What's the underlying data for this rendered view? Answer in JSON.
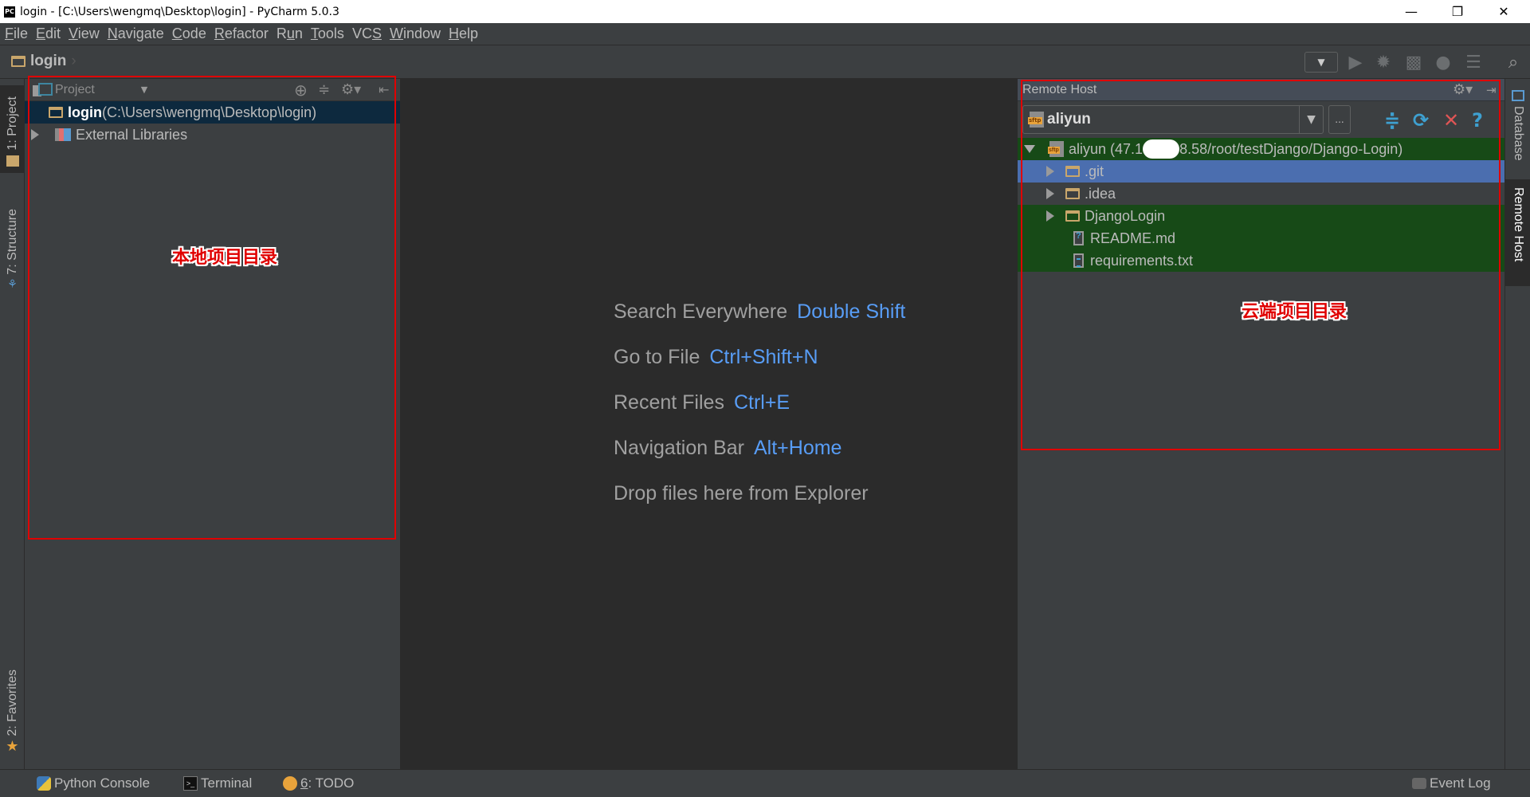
{
  "window": {
    "title": "login - [C:\\Users\\wengmq\\Desktop\\login] - PyCharm 5.0.3",
    "app_icon": "PC",
    "controls": {
      "minimize": "—",
      "restore": "❐",
      "close": "✕"
    }
  },
  "menu": [
    {
      "label": "File",
      "mnemonic": "F",
      "rest": "ile"
    },
    {
      "label": "Edit",
      "mnemonic": "E",
      "rest": "dit"
    },
    {
      "label": "View",
      "mnemonic": "V",
      "rest": "iew"
    },
    {
      "label": "Navigate",
      "mnemonic": "N",
      "rest": "avigate"
    },
    {
      "label": "Code",
      "mnemonic": "C",
      "rest": "ode"
    },
    {
      "label": "Refactor",
      "mnemonic": "R",
      "rest": "efactor"
    },
    {
      "label": "Run",
      "pre": "R",
      "mnemonic": "u",
      "rest": "n"
    },
    {
      "label": "Tools",
      "mnemonic": "T",
      "rest": "ools"
    },
    {
      "label": "VCS",
      "pre": "VC",
      "mnemonic": "S",
      "rest": ""
    },
    {
      "label": "Window",
      "mnemonic": "W",
      "rest": "indow"
    },
    {
      "label": "Help",
      "mnemonic": "H",
      "rest": "elp"
    }
  ],
  "navbar": {
    "breadcrumb": "login",
    "toolbar_icons": [
      "run-config-dropdown-icon",
      "run-icon",
      "debug-icon",
      "coverage-icon",
      "profile-icon",
      "concurrency-diagram-icon",
      "search-everywhere-icon"
    ]
  },
  "left_stripe": {
    "tabs": [
      {
        "label": "1: Project",
        "active": true
      },
      {
        "label": "7: Structure",
        "active": false
      },
      {
        "label": "2: Favorites",
        "active": false
      }
    ]
  },
  "project_panel": {
    "title": "Project",
    "tree": [
      {
        "name": "login",
        "path": " (C:\\Users\\wengmq\\Desktop\\login)",
        "type": "folder",
        "selected": true
      },
      {
        "name": "External Libraries",
        "type": "library",
        "collapsed": true
      }
    ],
    "annotation": "本地项目目录"
  },
  "editor": {
    "hints": [
      {
        "label": "Search Everywhere",
        "shortcut": "Double Shift"
      },
      {
        "label": "Go to File",
        "shortcut": "Ctrl+Shift+N"
      },
      {
        "label": "Recent Files",
        "shortcut": "Ctrl+E"
      },
      {
        "label": "Navigation Bar",
        "shortcut": "Alt+Home"
      },
      {
        "label": "Drop files here from Explorer",
        "shortcut": ""
      }
    ]
  },
  "remote_panel": {
    "title": "Remote Host",
    "host_selected": "aliyun",
    "more_label": "...",
    "root": {
      "label": "aliyun (47.1",
      "masked": true,
      "label_rest": "8.58/root/testDjango/Django-Login)"
    },
    "items": [
      {
        "name": ".git",
        "type": "folder",
        "state": "selected"
      },
      {
        "name": ".idea",
        "type": "folder",
        "state": "plain"
      },
      {
        "name": "DjangoLogin",
        "type": "folder",
        "state": "green"
      },
      {
        "name": "README.md",
        "type": "file-unknown",
        "state": "green"
      },
      {
        "name": "requirements.txt",
        "type": "file-text",
        "state": "green"
      }
    ],
    "annotation": "云端项目目录"
  },
  "right_stripe": {
    "tabs": [
      {
        "label": "Database",
        "active": false
      },
      {
        "label": "Remote Host",
        "active": true
      }
    ]
  },
  "statusbar": {
    "python_console": "Python Console",
    "terminal": "Terminal",
    "todo_num": "6",
    "todo_rest": ": TODO",
    "event_log": "Event Log"
  },
  "colors": {
    "accent_shortcut": "#589df6",
    "remote_added_bg": "#174a17",
    "selection_bg": "#4b6eaf",
    "annotation_red": "#e00000"
  }
}
